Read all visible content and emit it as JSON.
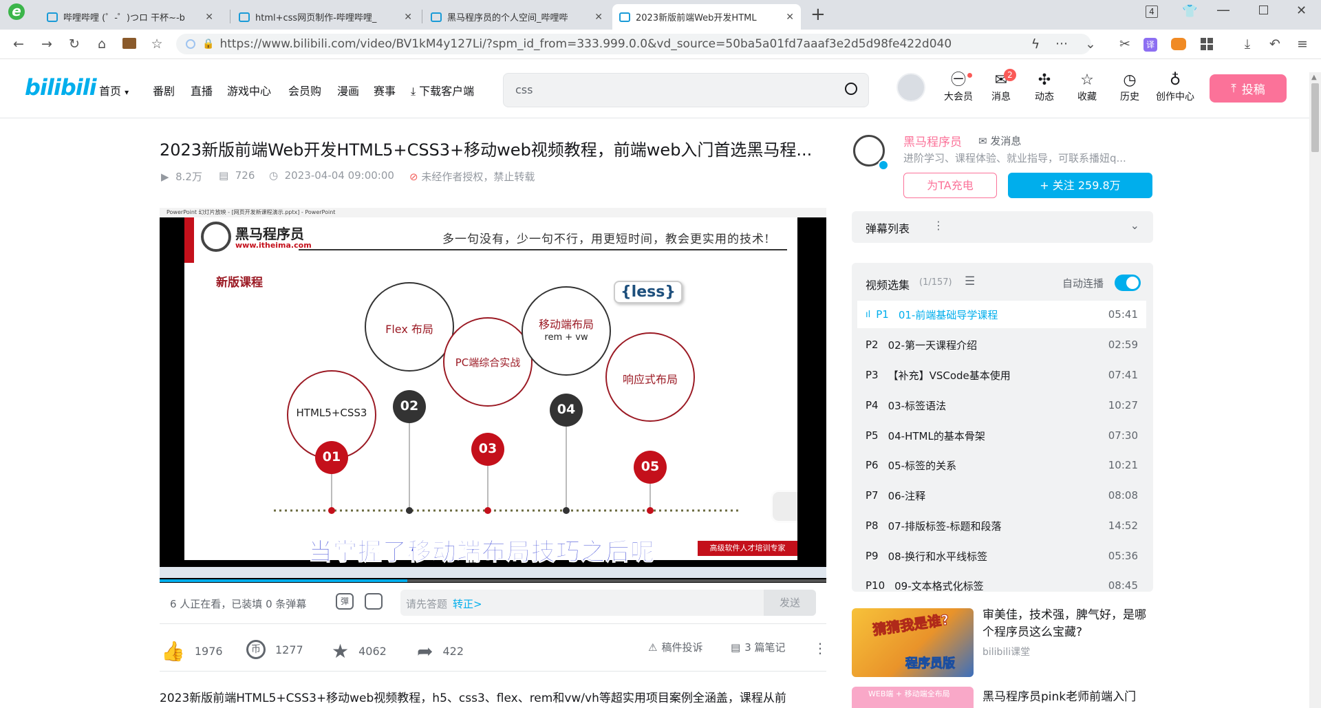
{
  "browser": {
    "tabs": [
      {
        "title": "哔哩哔哩 (゜-゜)つロ 干杯~-b",
        "active": false
      },
      {
        "title": "html+css网页制作-哔哩哔哩_",
        "active": false
      },
      {
        "title": "黑马程序员的个人空间_哔哩哔",
        "active": false
      },
      {
        "title": "2023新版前端Web开发HTML",
        "active": true
      }
    ],
    "new_tab": "+",
    "tab_count": "4",
    "url": "https://www.bilibili.com/video/BV1kM4y127Li/?spm_id_from=333.999.0.0&vd_source=50ba5a01fd7aaaf3e2d5d98fe422d040"
  },
  "header": {
    "logo": "bilibili",
    "nav": [
      "首页",
      "番剧",
      "直播",
      "游戏中心",
      "会员购",
      "漫画",
      "赛事",
      "下载客户端"
    ],
    "search_value": "css",
    "icons": [
      {
        "label": "大会员",
        "icon": "vip-icon",
        "badge": ""
      },
      {
        "label": "消息",
        "icon": "message-icon",
        "badge": "2"
      },
      {
        "label": "动态",
        "icon": "dynamic-icon",
        "badge": ""
      },
      {
        "label": "收藏",
        "icon": "favorite-icon",
        "badge": ""
      },
      {
        "label": "历史",
        "icon": "history-icon",
        "badge": ""
      },
      {
        "label": "创作中心",
        "icon": "creator-icon",
        "badge": ""
      }
    ],
    "upload": "投稿"
  },
  "video": {
    "title": "2023新版前端Web开发HTML5+CSS3+移动web视频教程，前端web入门首选黑马程...",
    "views": "8.2万",
    "danmaku": "726",
    "date": "2023-04-04 09:00:00",
    "copyright": "未经作者授权，禁止转载",
    "slide": {
      "window_title": "PowerPoint 幻灯片放映 - [网页开发新课程演示.pptx] - PowerPoint",
      "brand": "黑马程序员",
      "brand_url": "www.itheima.com",
      "slogan": "多一句没有，少一句不行，用更短时间，教会更实用的技术!",
      "section": "新版课程",
      "less_badge": "{less}",
      "items": [
        {
          "num": "01",
          "label": "HTML5+CSS3"
        },
        {
          "num": "02",
          "label": "Flex 布局"
        },
        {
          "num": "03",
          "label": "PC端综合实战"
        },
        {
          "num": "04",
          "label": "移动端布局",
          "sub": "rem + vw"
        },
        {
          "num": "05",
          "label": "响应式布局"
        }
      ],
      "subtitle": "当掌握了移动端布局技巧之后呢",
      "footer_tag": "高级软件人才培训专家"
    },
    "danmu_bar": {
      "watching": "6 人正在看，已装填 0 条弹幕",
      "placeholder": "请先答题",
      "link": "转正>",
      "send": "发送"
    },
    "actions": {
      "like": "1976",
      "coin": "1277",
      "fav": "4062",
      "share": "422",
      "report": "稿件投诉",
      "notes": "3 篇笔记"
    },
    "description": "2023新版前端HTML5+CSS3+移动web视频教程，h5、css3、flex、rem和vw/vh等超实用项目案例全涵盖，课程从前"
  },
  "uploader": {
    "name": "黑马程序员",
    "send_msg": "发消息",
    "desc": "进阶学习、课程体验、就业指导，可联系播妞q...",
    "charge": "为TA充电",
    "follow": "+ 关注 259.8万"
  },
  "danmaku_list": {
    "title": "弹幕列表"
  },
  "playlist": {
    "title": "视频选集",
    "count": "(1/157)",
    "autoplay": "自动连播",
    "episodes": [
      {
        "p": "P1",
        "name": "01-前端基础导学课程",
        "dur": "05:41",
        "current": true
      },
      {
        "p": "P2",
        "name": "02-第一天课程介绍",
        "dur": "02:59"
      },
      {
        "p": "P3",
        "name": "【补充】VSCode基本使用",
        "dur": "07:41"
      },
      {
        "p": "P4",
        "name": "03-标签语法",
        "dur": "10:27"
      },
      {
        "p": "P5",
        "name": "04-HTML的基本骨架",
        "dur": "07:30"
      },
      {
        "p": "P6",
        "name": "05-标签的关系",
        "dur": "10:21"
      },
      {
        "p": "P7",
        "name": "06-注释",
        "dur": "08:08"
      },
      {
        "p": "P8",
        "name": "07-排版标签-标题和段落",
        "dur": "14:52"
      },
      {
        "p": "P9",
        "name": "08-换行和水平线标签",
        "dur": "05:36"
      },
      {
        "p": "P10",
        "name": "09-文本格式化标签",
        "dur": "08:45"
      }
    ]
  },
  "recommend": [
    {
      "title": "审美佳，技术强，脾气好，是哪个程序员这么宝藏?",
      "author": "bilibili课堂",
      "thumb_text1": "猜猜我是谁?",
      "thumb_text2": "程序员版"
    },
    {
      "title": "黑马程序员pink老师前端入门",
      "thumb_text1": "WEB端 + 移动端全布局"
    }
  ],
  "colors": {
    "brand": "#00aeec",
    "pink": "#fb7299",
    "red": "#c4101b"
  }
}
